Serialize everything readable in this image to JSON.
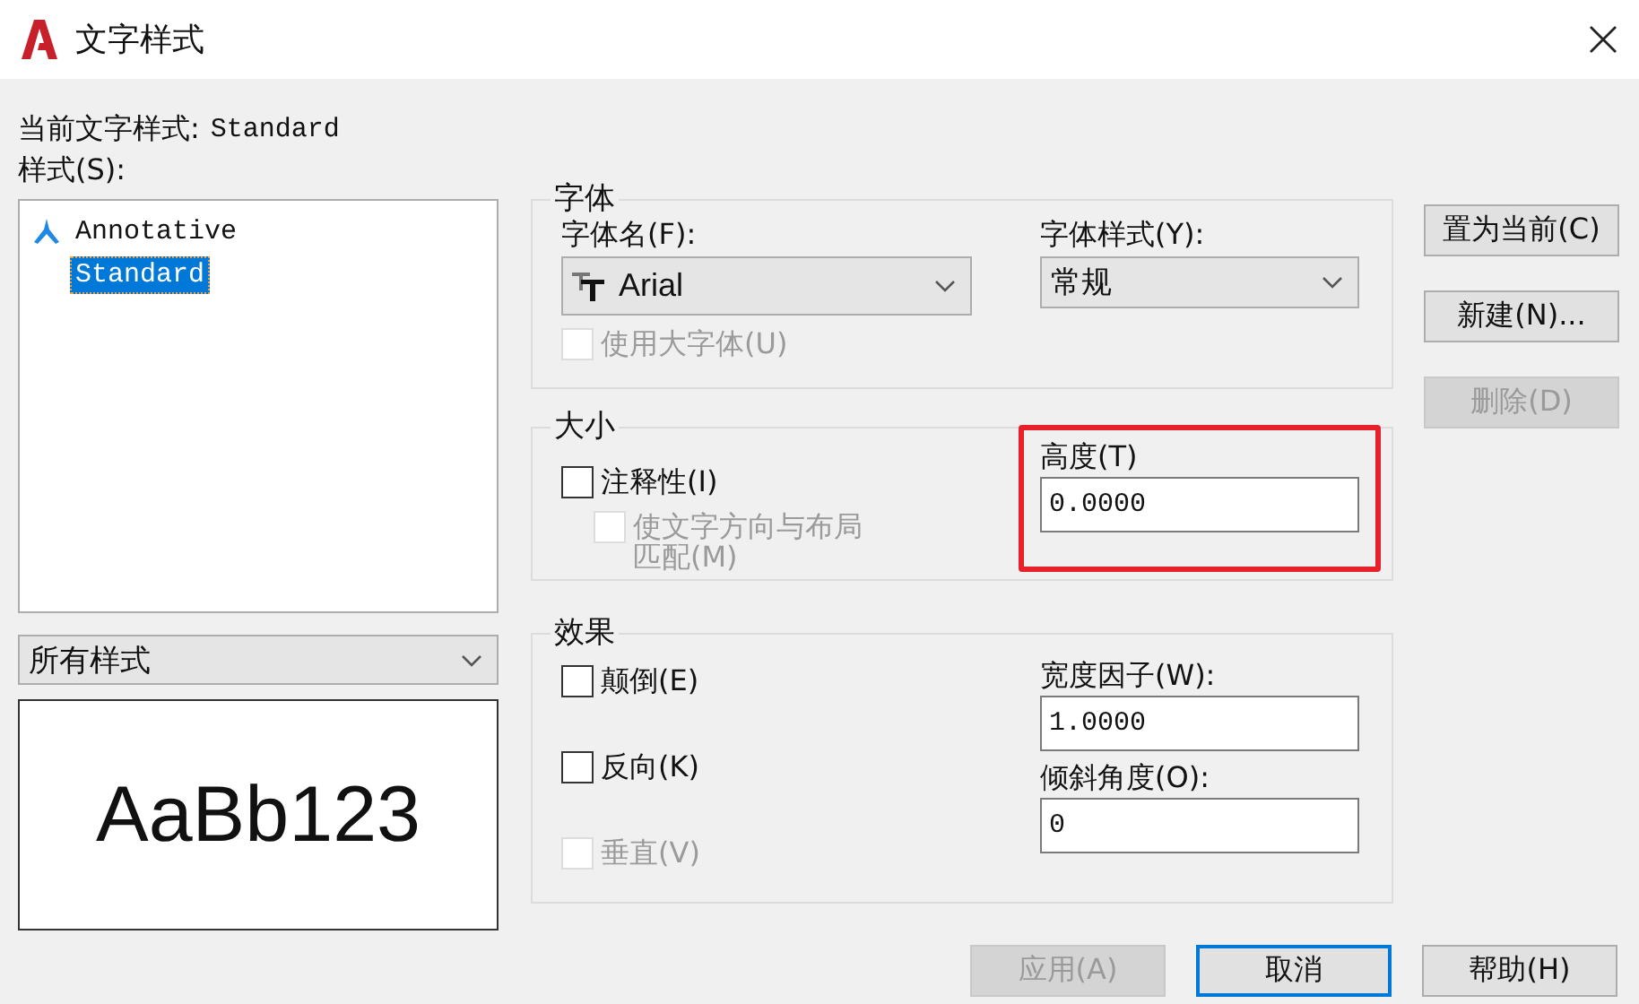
{
  "window": {
    "title": "文字样式"
  },
  "current_style": {
    "label": "当前文字样式:",
    "value": "Standard"
  },
  "styles": {
    "label": "样式(S):",
    "items": [
      {
        "name": "Annotative",
        "annotative": true,
        "selected": false
      },
      {
        "name": "Standard",
        "annotative": false,
        "selected": true
      }
    ]
  },
  "filter": {
    "value": "所有样式"
  },
  "preview": {
    "text": "AaBb123"
  },
  "font": {
    "legend": "字体",
    "name_label": "字体名(F):",
    "name_value": "Arial",
    "style_label": "字体样式(Y):",
    "style_value": "常规",
    "big_font": {
      "label": "使用大字体(U)",
      "checked": false,
      "disabled": true
    }
  },
  "size": {
    "legend": "大小",
    "checks": [
      {
        "label": "注释性(I)",
        "checked": false,
        "disabled": false
      },
      {
        "label": "使文字方向与布局匹配(M)",
        "checked": false,
        "disabled": true
      }
    ],
    "height_label": "高度(T)",
    "height_value": "0.0000",
    "highlighted": true
  },
  "effects": {
    "legend": "效果",
    "checks": [
      {
        "label": "颠倒(E)",
        "checked": false,
        "disabled": false
      },
      {
        "label": "反向(K)",
        "checked": false,
        "disabled": false
      },
      {
        "label": "垂直(V)",
        "checked": false,
        "disabled": true
      }
    ],
    "fields": [
      {
        "label": "宽度因子(W):",
        "value": "1.0000"
      },
      {
        "label": "倾斜角度(O):",
        "value": "0"
      }
    ]
  },
  "side_buttons": [
    {
      "label": "置为当前(C)",
      "disabled": false
    },
    {
      "label": "新建(N)...",
      "disabled": false
    },
    {
      "label": "删除(D)",
      "disabled": true
    }
  ],
  "bottom_buttons": [
    {
      "label": "应用(A)",
      "disabled": true,
      "default": false
    },
    {
      "label": "取消",
      "disabled": false,
      "default": true
    },
    {
      "label": "帮助(H)",
      "disabled": false,
      "default": false
    }
  ]
}
